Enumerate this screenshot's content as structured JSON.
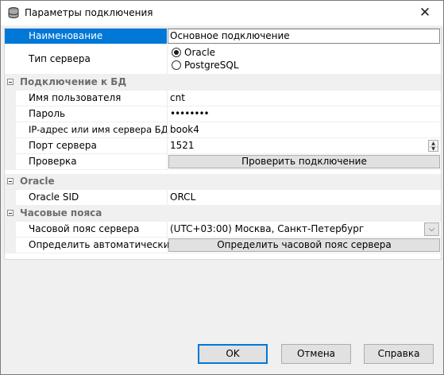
{
  "window": {
    "title": "Параметры подключения",
    "close_glyph": "✕",
    "app_icon": "database-icon"
  },
  "rows": {
    "name": {
      "label": "Наименование",
      "value": "Основное подключение"
    },
    "server_type": {
      "label": "Тип сервера",
      "options": [
        "Oracle",
        "PostgreSQL"
      ],
      "selected": "Oracle"
    },
    "cat_db": {
      "label": "Подключение к БД"
    },
    "username": {
      "label": "Имя пользователя",
      "value": "cnt"
    },
    "password": {
      "label": "Пароль",
      "value": "••••••••"
    },
    "host": {
      "label": "IP-адрес или имя сервера БД",
      "value": "book4"
    },
    "port": {
      "label": "Порт сервера",
      "value": "1521"
    },
    "check": {
      "label": "Проверка",
      "button": "Проверить подключение"
    },
    "cat_oracle": {
      "label": "Oracle"
    },
    "sid": {
      "label": "Oracle SID",
      "value": "ORCL"
    },
    "cat_tz": {
      "label": "Часовые пояса"
    },
    "timezone": {
      "label": "Часовой пояс сервера",
      "value": "(UTC+03:00) Москва, Санкт-Петербург"
    },
    "autodetect": {
      "label": "Определить автоматически",
      "button": "Определить часовой пояс сервера"
    }
  },
  "buttons": {
    "ok": "OK",
    "cancel": "Отмена",
    "help": "Справка"
  },
  "colors": {
    "selection": "#0078d7",
    "category_text": "#6d6d6d",
    "background": "#f0f0f0"
  }
}
